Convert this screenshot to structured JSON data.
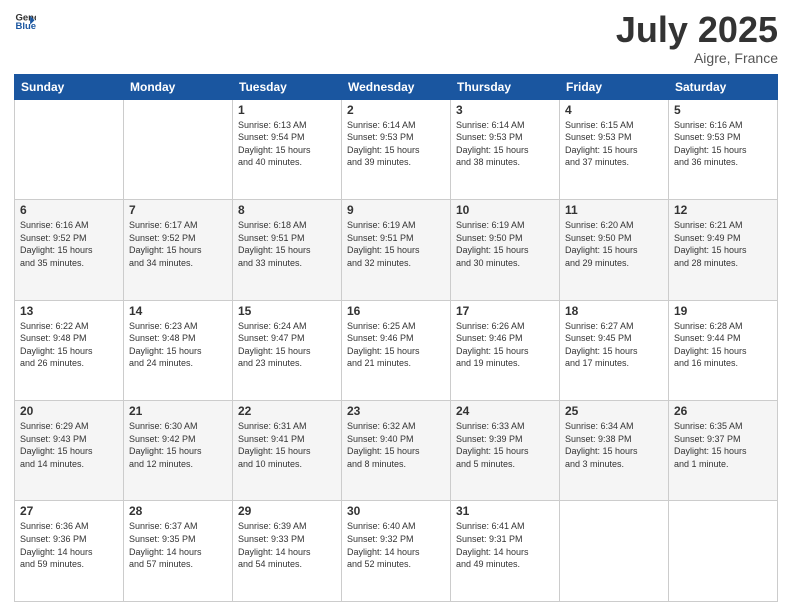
{
  "header": {
    "logo_line1": "General",
    "logo_line2": "Blue",
    "month": "July 2025",
    "location": "Aigre, France"
  },
  "weekdays": [
    "Sunday",
    "Monday",
    "Tuesday",
    "Wednesday",
    "Thursday",
    "Friday",
    "Saturday"
  ],
  "weeks": [
    [
      {
        "day": "",
        "info": ""
      },
      {
        "day": "",
        "info": ""
      },
      {
        "day": "1",
        "info": "Sunrise: 6:13 AM\nSunset: 9:54 PM\nDaylight: 15 hours\nand 40 minutes."
      },
      {
        "day": "2",
        "info": "Sunrise: 6:14 AM\nSunset: 9:53 PM\nDaylight: 15 hours\nand 39 minutes."
      },
      {
        "day": "3",
        "info": "Sunrise: 6:14 AM\nSunset: 9:53 PM\nDaylight: 15 hours\nand 38 minutes."
      },
      {
        "day": "4",
        "info": "Sunrise: 6:15 AM\nSunset: 9:53 PM\nDaylight: 15 hours\nand 37 minutes."
      },
      {
        "day": "5",
        "info": "Sunrise: 6:16 AM\nSunset: 9:53 PM\nDaylight: 15 hours\nand 36 minutes."
      }
    ],
    [
      {
        "day": "6",
        "info": "Sunrise: 6:16 AM\nSunset: 9:52 PM\nDaylight: 15 hours\nand 35 minutes."
      },
      {
        "day": "7",
        "info": "Sunrise: 6:17 AM\nSunset: 9:52 PM\nDaylight: 15 hours\nand 34 minutes."
      },
      {
        "day": "8",
        "info": "Sunrise: 6:18 AM\nSunset: 9:51 PM\nDaylight: 15 hours\nand 33 minutes."
      },
      {
        "day": "9",
        "info": "Sunrise: 6:19 AM\nSunset: 9:51 PM\nDaylight: 15 hours\nand 32 minutes."
      },
      {
        "day": "10",
        "info": "Sunrise: 6:19 AM\nSunset: 9:50 PM\nDaylight: 15 hours\nand 30 minutes."
      },
      {
        "day": "11",
        "info": "Sunrise: 6:20 AM\nSunset: 9:50 PM\nDaylight: 15 hours\nand 29 minutes."
      },
      {
        "day": "12",
        "info": "Sunrise: 6:21 AM\nSunset: 9:49 PM\nDaylight: 15 hours\nand 28 minutes."
      }
    ],
    [
      {
        "day": "13",
        "info": "Sunrise: 6:22 AM\nSunset: 9:48 PM\nDaylight: 15 hours\nand 26 minutes."
      },
      {
        "day": "14",
        "info": "Sunrise: 6:23 AM\nSunset: 9:48 PM\nDaylight: 15 hours\nand 24 minutes."
      },
      {
        "day": "15",
        "info": "Sunrise: 6:24 AM\nSunset: 9:47 PM\nDaylight: 15 hours\nand 23 minutes."
      },
      {
        "day": "16",
        "info": "Sunrise: 6:25 AM\nSunset: 9:46 PM\nDaylight: 15 hours\nand 21 minutes."
      },
      {
        "day": "17",
        "info": "Sunrise: 6:26 AM\nSunset: 9:46 PM\nDaylight: 15 hours\nand 19 minutes."
      },
      {
        "day": "18",
        "info": "Sunrise: 6:27 AM\nSunset: 9:45 PM\nDaylight: 15 hours\nand 17 minutes."
      },
      {
        "day": "19",
        "info": "Sunrise: 6:28 AM\nSunset: 9:44 PM\nDaylight: 15 hours\nand 16 minutes."
      }
    ],
    [
      {
        "day": "20",
        "info": "Sunrise: 6:29 AM\nSunset: 9:43 PM\nDaylight: 15 hours\nand 14 minutes."
      },
      {
        "day": "21",
        "info": "Sunrise: 6:30 AM\nSunset: 9:42 PM\nDaylight: 15 hours\nand 12 minutes."
      },
      {
        "day": "22",
        "info": "Sunrise: 6:31 AM\nSunset: 9:41 PM\nDaylight: 15 hours\nand 10 minutes."
      },
      {
        "day": "23",
        "info": "Sunrise: 6:32 AM\nSunset: 9:40 PM\nDaylight: 15 hours\nand 8 minutes."
      },
      {
        "day": "24",
        "info": "Sunrise: 6:33 AM\nSunset: 9:39 PM\nDaylight: 15 hours\nand 5 minutes."
      },
      {
        "day": "25",
        "info": "Sunrise: 6:34 AM\nSunset: 9:38 PM\nDaylight: 15 hours\nand 3 minutes."
      },
      {
        "day": "26",
        "info": "Sunrise: 6:35 AM\nSunset: 9:37 PM\nDaylight: 15 hours\nand 1 minute."
      }
    ],
    [
      {
        "day": "27",
        "info": "Sunrise: 6:36 AM\nSunset: 9:36 PM\nDaylight: 14 hours\nand 59 minutes."
      },
      {
        "day": "28",
        "info": "Sunrise: 6:37 AM\nSunset: 9:35 PM\nDaylight: 14 hours\nand 57 minutes."
      },
      {
        "day": "29",
        "info": "Sunrise: 6:39 AM\nSunset: 9:33 PM\nDaylight: 14 hours\nand 54 minutes."
      },
      {
        "day": "30",
        "info": "Sunrise: 6:40 AM\nSunset: 9:32 PM\nDaylight: 14 hours\nand 52 minutes."
      },
      {
        "day": "31",
        "info": "Sunrise: 6:41 AM\nSunset: 9:31 PM\nDaylight: 14 hours\nand 49 minutes."
      },
      {
        "day": "",
        "info": ""
      },
      {
        "day": "",
        "info": ""
      }
    ]
  ]
}
